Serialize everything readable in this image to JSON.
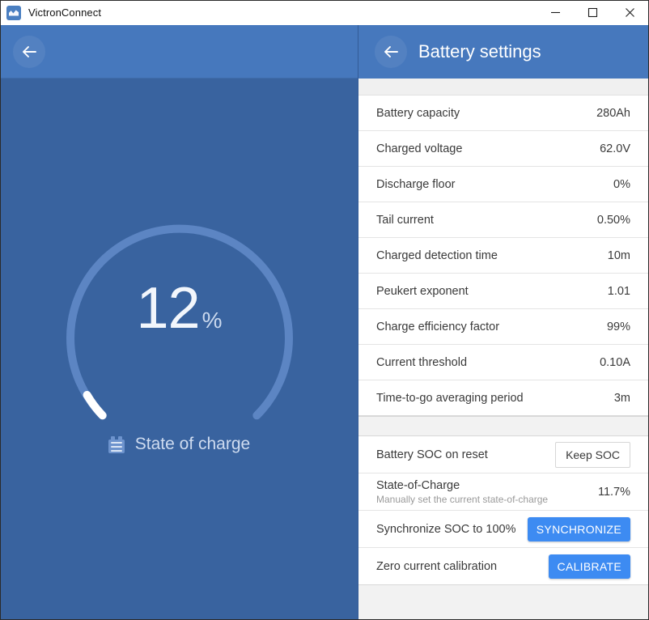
{
  "window": {
    "app_title": "VictronConnect",
    "app_icon": "victron-logo-icon",
    "minimize_label": "—",
    "maximize_label": "□",
    "close_label": "✕"
  },
  "left_pane": {
    "back_icon": "arrow-left-icon",
    "gauge": {
      "value": "12",
      "unit": "%",
      "label": "State of charge",
      "label_icon": "battery-icon",
      "percent": 12,
      "track_color": "#5c85c3",
      "progress_color": "#ffffff",
      "background_color": "#39639f"
    }
  },
  "right_pane": {
    "back_icon": "arrow-left-icon",
    "title": "Battery settings",
    "accent_color": "#3d8bf2",
    "header_color": "#4678bd",
    "settings": [
      {
        "label": "Battery capacity",
        "value": "280Ah"
      },
      {
        "label": "Charged voltage",
        "value": "62.0V"
      },
      {
        "label": "Discharge floor",
        "value": "0%"
      },
      {
        "label": "Tail current",
        "value": "0.50%"
      },
      {
        "label": "Charged detection time",
        "value": "10m"
      },
      {
        "label": "Peukert exponent",
        "value": "1.01"
      },
      {
        "label": "Charge efficiency factor",
        "value": "99%"
      },
      {
        "label": "Current threshold",
        "value": "0.10A"
      },
      {
        "label": "Time-to-go averaging period",
        "value": "3m"
      }
    ],
    "actions": {
      "soc_on_reset": {
        "label": "Battery SOC on reset",
        "button_label": "Keep SOC"
      },
      "state_of_charge": {
        "label": "State-of-Charge",
        "sublabel": "Manually set the current state-of-charge",
        "value": "11.7%"
      },
      "synchronize": {
        "label": "Synchronize SOC to 100%",
        "button_label": "SYNCHRONIZE"
      },
      "calibrate": {
        "label": "Zero current calibration",
        "button_label": "CALIBRATE"
      }
    }
  }
}
